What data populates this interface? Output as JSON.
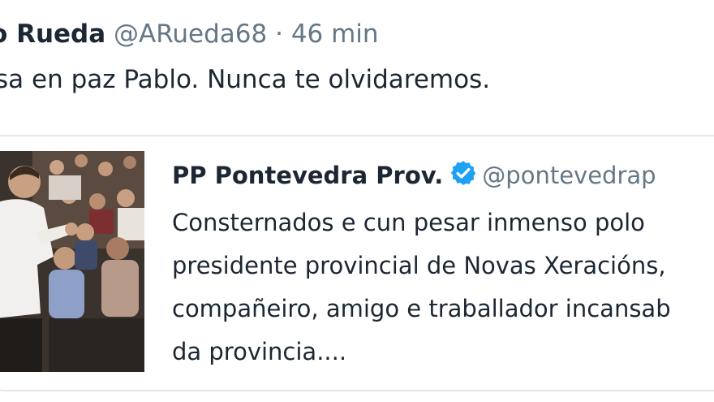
{
  "tweet": {
    "author_name": "o Rueda",
    "handle": "@ARueda68",
    "separator": "·",
    "time": "46 min",
    "text": "sa en paz Pablo. Nunca te olvidaremos."
  },
  "quoted_tweet": {
    "author_name": "PP Pontevedra Prov.",
    "verified_icon": "verified-badge-icon",
    "handle": "@pontevedrap",
    "text_lines": [
      "Consternados e cun pesar inmenso polo",
      "presidente provincial de Novas Xeracións,",
      "compañeiro, amigo e traballador incansab",
      "da provincia...."
    ]
  },
  "colors": {
    "text": "#1c2733",
    "secondary": "#657786",
    "verified": "#1da1f2",
    "border": "#e1e8ed"
  }
}
